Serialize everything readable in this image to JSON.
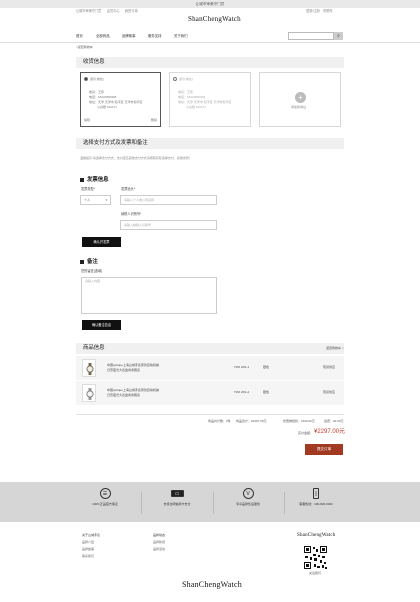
{
  "topbar": {
    "notice": "让城市审美守门员"
  },
  "top_links": {
    "left": [
      "让城市审美守门员",
      "会员中心",
      "我的订单"
    ],
    "right": [
      "登录/注册",
      "购物车"
    ]
  },
  "logo": "ShanChengWatch",
  "nav": [
    "首页",
    "全部商品",
    "品牌故事",
    "服务支持",
    "关于我们"
  ],
  "search": {
    "placeholder": ""
  },
  "breadcrumb": "<返回购物车",
  "address": {
    "title": "收货信息",
    "cards": [
      {
        "tag": "[默认地址]",
        "name": "收货：王伟",
        "phone": "电话：18222860966",
        "addr": "地址：天津 天津市 和平区 天津市和平区",
        "addr2": "小白楼 100171",
        "edit": "编辑",
        "delete": "删除"
      },
      {
        "tag": "[默认地址]",
        "name": "收货：王伟",
        "phone": "电话：18222860966",
        "addr": "地址：天津 天津市 和平区 天津市和平区",
        "addr2": "小白楼 100171"
      }
    ],
    "add_label": "添加新地址"
  },
  "payment": {
    "title": "选择支付方式及发票和备注",
    "note": "温馨提示:请选择支付方式，支付宝及其他支付方式请按照实际选择支付，感谢支持！"
  },
  "invoice": {
    "title": "发票信息",
    "type_label": "发票类型*",
    "type_value": "个人",
    "header_label": "发票抬头*",
    "header_placeholder": "请输入个人或公司名称",
    "taxid_label": "纳税人识别号*",
    "taxid_placeholder": "请输入纳税人识别号",
    "confirm": "确认开发票"
  },
  "remark": {
    "title": "备注",
    "label": "您的留言(选填)",
    "placeholder": "请输入内容",
    "confirm": "确认备注信息"
  },
  "goods": {
    "title": "商品信息",
    "back_link": "返回购物车 >",
    "rows": [
      {
        "name": "中国optique上海山城手表男款自动机械",
        "name2": "日历夜光大表盘商务腕表",
        "model": "TWJ 2D1-1",
        "color": "银色",
        "status": "现货供应"
      },
      {
        "name": "中国optique上海山城手表男款自动机械",
        "name2": "日历夜光大表盘商务腕表",
        "model": "TWJ 2D1-2",
        "color": "银色",
        "status": "现货供应"
      }
    ]
  },
  "summary": {
    "items": [
      "商品共计数：2件",
      "商品合计：¥2297.00元",
      "优惠券抵扣：¥100.00元",
      "运费：¥0.00元"
    ],
    "pay_label": "实付金额：",
    "pay_value": "¥2297.00元",
    "submit": "提交订单"
  },
  "features": [
    {
      "icon": "pure-icon",
      "glyph": "☰",
      "label": "100%正品官方保证"
    },
    {
      "icon": "card-icon",
      "glyph": "▭",
      "label": "支持全网信用卡支付"
    },
    {
      "icon": "check-icon",
      "glyph": "V",
      "label": "专享品牌售后服务"
    },
    {
      "icon": "phone-icon",
      "glyph": "▯",
      "label": "客服热线：400-820-6362"
    }
  ],
  "footer": {
    "col1": {
      "title": "关于山城手表",
      "links": [
        "品牌介绍",
        "品牌故事",
        "联系我们"
      ]
    },
    "col2": {
      "title": "品牌动态",
      "links": [
        "品牌新闻",
        "品牌活动"
      ]
    },
    "qr_caption": "关注我们",
    "logo": "ShanChengWatch"
  }
}
